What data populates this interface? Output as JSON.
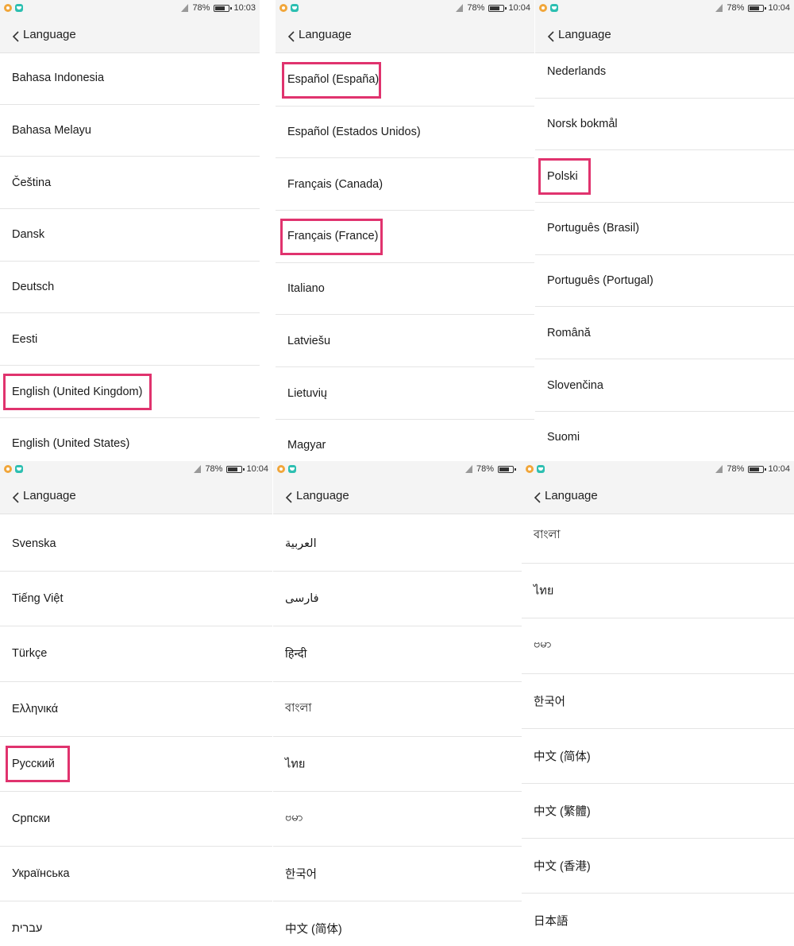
{
  "screens": [
    {
      "status": {
        "battery": "78%",
        "time": "10:03",
        "battery_level": 0.78
      },
      "nav": {
        "title": "Language"
      },
      "items": [
        "Bahasa Indonesia",
        "Bahasa Melayu",
        "Čeština",
        "Dansk",
        "Deutsch",
        "Eesti",
        "English (United Kingdom)",
        "English (United States)"
      ],
      "highlighted": [
        "English (United Kingdom)"
      ]
    },
    {
      "status": {
        "battery": "78%",
        "time": "10:04",
        "battery_level": 0.78
      },
      "nav": {
        "title": "Language"
      },
      "items": [
        "Español (España)",
        "Español (Estados Unidos)",
        "Français (Canada)",
        "Français (France)",
        "Italiano",
        "Latviešu",
        "Lietuvių",
        "Magyar"
      ],
      "highlighted": [
        "Español (España)",
        "Français (France)"
      ]
    },
    {
      "status": {
        "battery": "78%",
        "time": "10:04",
        "battery_level": 0.78
      },
      "nav": {
        "title": "Language"
      },
      "items": [
        "Nederlands",
        "Norsk bokmål",
        "Polski",
        "Português (Brasil)",
        "Português (Portugal)",
        "Română",
        "Slovenčina",
        "Suomi"
      ],
      "highlighted": [
        "Polski"
      ]
    },
    {
      "status": {
        "battery": "78%",
        "time": "10:04",
        "battery_level": 0.78
      },
      "nav": {
        "title": "Language"
      },
      "items": [
        "Svenska",
        "Tiếng Việt",
        "Türkçe",
        "Ελληνικά",
        "Русский",
        "Српски",
        "Українська",
        "עברית"
      ],
      "highlighted": [
        "Русский"
      ]
    },
    {
      "status": {
        "battery": "78%",
        "time": "",
        "battery_level": 0.78
      },
      "nav": {
        "title": "Language"
      },
      "items": [
        "العربية",
        "فارسی",
        "हिन्दी",
        "বাংলা",
        "ไทย",
        "ဗမာ",
        "한국어",
        "中文 (简体)"
      ],
      "highlighted": []
    },
    {
      "status": {
        "battery": "78%",
        "time": "10:04",
        "battery_level": 0.78
      },
      "nav": {
        "title": "Language"
      },
      "items": [
        "বাংলা",
        "ไทย",
        "ဗမာ",
        "한국어",
        "中文 (简体)",
        "中文 (繁體)",
        "中文 (香港)",
        "日本語"
      ],
      "highlighted": []
    }
  ],
  "colors": {
    "highlight": "#e0336e",
    "bar_bg": "#f4f4f4",
    "divider": "#e4e4e4"
  },
  "icons": {
    "status_left": [
      "notification-icon",
      "app-icon"
    ],
    "back": "chevron-left-icon",
    "signal": "signal-icon",
    "battery": "battery-icon"
  }
}
